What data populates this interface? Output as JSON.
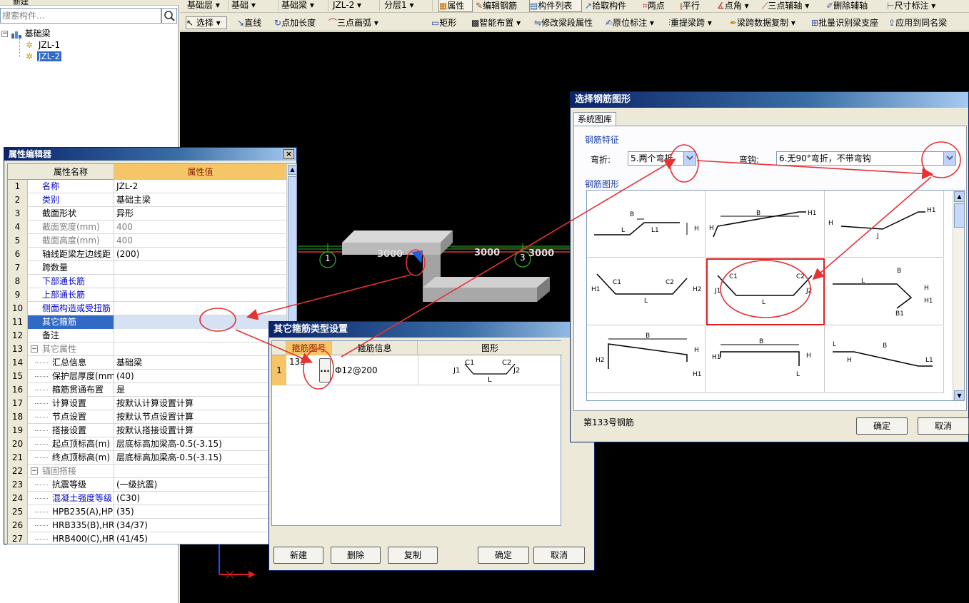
{
  "left_panel": {
    "top_label": "新建",
    "search_placeholder": "搜索构件...",
    "tree_root": "基础梁",
    "tree_items": [
      "JZL-1",
      "JZL-2"
    ]
  },
  "toolbar1": {
    "floor": "基础层",
    "category": "基础",
    "type": "基础梁",
    "element": "JZL-2",
    "layer": "分层1",
    "btn_properties": "属性",
    "btn_edit_rebar": "编辑钢筋",
    "btn_component_list": "构件列表",
    "btn_pick": "拾取构件",
    "btn_two_point": "两点",
    "btn_parallel": "平行",
    "btn_point_angle": "点角",
    "btn_three_point_axis": "三点辅轴",
    "btn_delete_axis": "删除辅轴",
    "btn_dimension": "尺寸标注"
  },
  "toolbar2": {
    "select": "选择",
    "line": "直线",
    "point_length": "点加长度",
    "arc": "三点画弧",
    "rect": "矩形",
    "smart_layout": "智能布置",
    "modify_span": "修改梁段属性",
    "in_place": "原位标注",
    "redo_span": "重提梁跨",
    "copy_span": "梁跨数据复制",
    "batch_identify": "批量识别梁支座",
    "apply_same": "应用到同名梁"
  },
  "canvas": {
    "axis_labels": [
      "1",
      "3"
    ],
    "dims": [
      "3000",
      "3000",
      "3000"
    ]
  },
  "prop_editor": {
    "title": "属性编辑器",
    "col_name": "属性名称",
    "col_value": "属性值",
    "rows": [
      {
        "no": "1",
        "name": "名称",
        "value": "JZL-2",
        "style": "link"
      },
      {
        "no": "2",
        "name": "类别",
        "value": "基础主梁",
        "style": "link"
      },
      {
        "no": "3",
        "name": "截面形状",
        "value": "异形",
        "style": ""
      },
      {
        "no": "4",
        "name": "截面宽度(mm)",
        "value": "400",
        "style": "gray"
      },
      {
        "no": "5",
        "name": "截面高度(mm)",
        "value": "400",
        "style": "gray"
      },
      {
        "no": "6",
        "name": "轴线距梁左边线距",
        "value": "(200)",
        "style": ""
      },
      {
        "no": "7",
        "name": "跨数量",
        "value": "",
        "style": ""
      },
      {
        "no": "8",
        "name": "下部通长筋",
        "value": "",
        "style": "link"
      },
      {
        "no": "9",
        "name": "上部通长筋",
        "value": "",
        "style": "link"
      },
      {
        "no": "10",
        "name": "侧面构造或受扭筋",
        "value": "",
        "style": "link"
      },
      {
        "no": "11",
        "name": "其它箍筋",
        "value": "",
        "style": "sel"
      },
      {
        "no": "12",
        "name": "备注",
        "value": "",
        "style": ""
      },
      {
        "no": "13",
        "name": "其它属性",
        "value": "",
        "style": "group"
      },
      {
        "no": "14",
        "name": "汇总信息",
        "value": "基础梁",
        "style": "child"
      },
      {
        "no": "15",
        "name": "保护层厚度(mm)",
        "value": "(40)",
        "style": "child"
      },
      {
        "no": "16",
        "name": "箍筋贯通布置",
        "value": "是",
        "style": "child"
      },
      {
        "no": "17",
        "name": "计算设置",
        "value": "按默认计算设置计算",
        "style": "child"
      },
      {
        "no": "18",
        "name": "节点设置",
        "value": "按默认节点设置计算",
        "style": "child"
      },
      {
        "no": "19",
        "name": "搭接设置",
        "value": "按默认搭接设置计算",
        "style": "child"
      },
      {
        "no": "20",
        "name": "起点顶标高(m)",
        "value": "层底标高加梁高-0.5(-3.15)",
        "style": "child"
      },
      {
        "no": "21",
        "name": "终点顶标高(m)",
        "value": "层底标高加梁高-0.5(-3.15)",
        "style": "child"
      },
      {
        "no": "22",
        "name": "锚固搭接",
        "value": "",
        "style": "group"
      },
      {
        "no": "23",
        "name": "抗震等级",
        "value": "(一级抗震)",
        "style": "child"
      },
      {
        "no": "24",
        "name": "混凝土强度等级",
        "value": "(C30)",
        "style": "childlink"
      },
      {
        "no": "25",
        "name": "HPB235(A),HPB3",
        "value": "(35)",
        "style": "child"
      },
      {
        "no": "26",
        "name": "HRB335(B),HRB3",
        "value": "(34/37)",
        "style": "child"
      },
      {
        "no": "27",
        "name": "HRB400(C),HRB4",
        "value": "(41/45)",
        "style": "child"
      }
    ]
  },
  "stirrup_dialog": {
    "title": "其它箍筋类型设置",
    "col_shape_no": "箍筋图号",
    "col_info": "箍筋信息",
    "col_figure": "图形",
    "row_no": "1",
    "shape_no": "133",
    "ellipsis": "...",
    "info": "Φ12@200",
    "btn_new": "新建",
    "btn_delete": "删除",
    "btn_copy": "复制",
    "btn_ok": "确定",
    "btn_cancel": "取消"
  },
  "shape_dialog": {
    "title": "选择钢筋图形",
    "tab": "系统图库",
    "group_features": "钢筋特征",
    "bend_label": "弯折:",
    "bend_value": "5.两个弯折",
    "hook_label": "弯钩:",
    "hook_value": "6.无90°弯折，不带弯钩",
    "group_shapes": "钢筋图形",
    "status": "第133号钢筋",
    "btn_ok": "确定",
    "btn_cancel": "取消"
  },
  "colors": {
    "annotation_red": "#e53333",
    "selected_blue": "#316ac5",
    "header_orange": "#f6c567"
  }
}
